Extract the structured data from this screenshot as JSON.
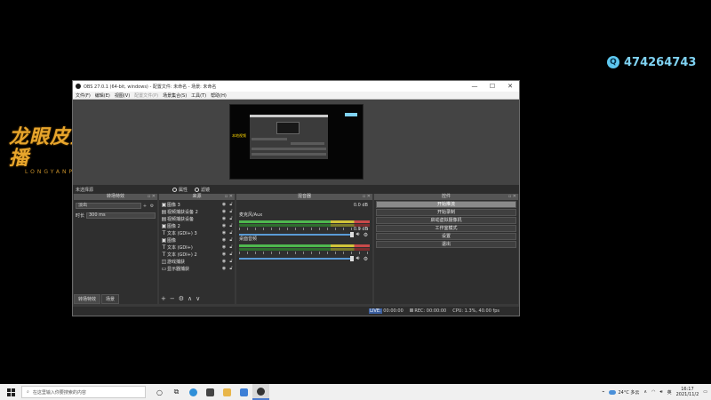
{
  "overlay": {
    "logo_main": "龙眼皮直播",
    "logo_sub": "LONGYANPI",
    "qq_icon": "qq-penguin-icon",
    "qq_number": "474264743"
  },
  "window": {
    "title": "OBS 27.0.1 (64-bit, windows) - 配置文件: 未命名 - 场景: 未命名",
    "menu": [
      "文件(F)",
      "编辑(E)",
      "视图(V)",
      "配置文件(P)",
      "场景集合(S)",
      "工具(T)",
      "帮助(H)"
    ],
    "menu_disabled_index": 3
  },
  "preview": {
    "label": "本地视频"
  },
  "source_strip": {
    "no_source": "未选择源",
    "properties": "属性",
    "filters": "滤镜"
  },
  "docks": {
    "filters_title": "转场特效",
    "filter_type": "淡出",
    "filter_duration_label": "时长",
    "filter_duration": "300 ms",
    "tab_transitions": "转场特效",
    "tab_scenes": "场景",
    "sources_title": "来源",
    "sources": [
      {
        "icon": "image-icon",
        "name": "图像 3"
      },
      {
        "icon": "video-capture-icon",
        "name": "视频捕获设备 2"
      },
      {
        "icon": "video-capture-icon",
        "name": "视频捕获设备"
      },
      {
        "icon": "image-icon",
        "name": "图像 2"
      },
      {
        "icon": "text-icon",
        "name": "文本 (GDI+) 3"
      },
      {
        "icon": "image-icon",
        "name": "图像"
      },
      {
        "icon": "text-icon",
        "name": "文本 (GDI+)"
      },
      {
        "icon": "text-icon",
        "name": "文本 (GDI+) 2"
      },
      {
        "icon": "game-capture-icon",
        "name": "游戏捕获"
      },
      {
        "icon": "display-capture-icon",
        "name": "显示器捕获"
      }
    ],
    "mixer_title": "混音器",
    "mixer_channels": [
      {
        "name": "麦克风/Aux",
        "db": "0.0 dB"
      },
      {
        "name": "桌面音频",
        "db": "0.0 dB"
      }
    ],
    "controls_title": "控件",
    "controls": [
      "开始推流",
      "开始录制",
      "启动虚拟摄像机",
      "工作室模式",
      "设置",
      "退出"
    ]
  },
  "statusbar": {
    "live_label": "LIVE:",
    "live_time": "00:00:00",
    "rec_label": "REC:",
    "rec_time": "00:00:00",
    "cpu": "CPU: 1.3%, 40.00 fps"
  },
  "taskbar": {
    "search_placeholder": "在这里输入你要搜索的内容",
    "weather": "24°C 多云",
    "ime": "英",
    "time": "16:17",
    "date": "2021/11/2"
  }
}
